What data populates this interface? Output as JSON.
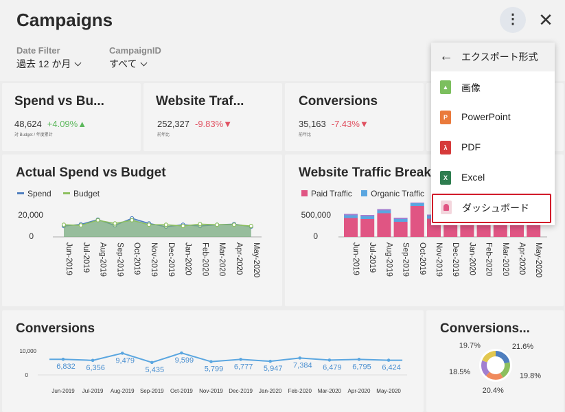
{
  "header": {
    "title": "Campaigns",
    "filters": [
      {
        "label": "Date Filter",
        "value": "過去 12 か月"
      },
      {
        "label": "CampaignID",
        "value": "すべて"
      }
    ],
    "more_icon": "⋮",
    "close_icon": "✕"
  },
  "kpis": [
    {
      "title": "Spend vs Bu...",
      "value": "48,624",
      "delta": "+4.09%▲",
      "sub": "対 Budget / 年度累計"
    },
    {
      "title": "Website Traf...",
      "value": "252,327",
      "delta": "-9.83%▼",
      "sub": "前年比"
    },
    {
      "title": "Conversions",
      "value": "35,163",
      "delta": "-7.43%▼",
      "sub": "前年比"
    }
  ],
  "months": [
    "Jun-2019",
    "Jul-2019",
    "Aug-2019",
    "Sep-2019",
    "Oct-2019",
    "Nov-2019",
    "Dec-2019",
    "Jan-2020",
    "Feb-2020",
    "Mar-2020",
    "Apr-2020",
    "May-2020"
  ],
  "spend_chart": {
    "title": "Actual Spend vs Budget",
    "legend": [
      "Spend",
      "Budget"
    ],
    "y_ticks": [
      "20,000",
      "0"
    ]
  },
  "traffic_chart": {
    "title": "Website Traffic Breakdown",
    "legend": [
      "Paid Traffic",
      "Organic Traffic"
    ],
    "y_ticks": [
      "500,000",
      "0"
    ]
  },
  "conversions_chart": {
    "title": "Conversions",
    "y_ticks": [
      "10,000",
      "0"
    ]
  },
  "donut_chart": {
    "title": "Conversions..."
  },
  "chart_data": [
    {
      "type": "area",
      "title": "Actual Spend vs Budget",
      "categories": [
        "Jun-2019",
        "Jul-2019",
        "Aug-2019",
        "Sep-2019",
        "Oct-2019",
        "Nov-2019",
        "Dec-2019",
        "Jan-2020",
        "Feb-2020",
        "Mar-2020",
        "Apr-2020",
        "May-2020"
      ],
      "ylim": [
        0,
        30000
      ],
      "series": [
        {
          "name": "Spend",
          "values": [
            8500,
            9800,
            13500,
            9000,
            14500,
            10500,
            8000,
            9500,
            8500,
            9500,
            10000,
            8000
          ]
        },
        {
          "name": "Budget",
          "values": [
            9500,
            9000,
            13000,
            10500,
            13000,
            9500,
            9500,
            8500,
            10000,
            9500,
            9500,
            8500
          ]
        }
      ],
      "colors": {
        "Spend": "#4f7fbf",
        "Budget": "#8cbf5e"
      }
    },
    {
      "type": "bar",
      "title": "Website Traffic Breakdown",
      "categories": [
        "Jun-2019",
        "Jul-2019",
        "Aug-2019",
        "Sep-2019",
        "Oct-2019",
        "Nov-2019",
        "Dec-2019",
        "Jan-2020",
        "Feb-2020",
        "Mar-2020",
        "Apr-2020",
        "May-2020"
      ],
      "ylim": [
        0,
        700000
      ],
      "series": [
        {
          "name": "Paid Traffic",
          "values": [
            275000,
            260000,
            345000,
            220000,
            450000,
            265000,
            275000,
            235000,
            270000,
            265000,
            260000,
            265000
          ]
        },
        {
          "name": "Organic Traffic",
          "values": [
            40000,
            40000,
            40000,
            40000,
            40000,
            40000,
            40000,
            40000,
            40000,
            40000,
            40000,
            40000
          ]
        }
      ],
      "colors": {
        "Paid Traffic": "#e05583",
        "Organic Traffic": "#5aa6e0"
      }
    },
    {
      "type": "line",
      "title": "Conversions",
      "categories": [
        "Jun-2019",
        "Jul-2019",
        "Aug-2019",
        "Sep-2019",
        "Oct-2019",
        "Nov-2019",
        "Dec-2019",
        "Jan-2020",
        "Feb-2020",
        "Mar-2020",
        "Apr-2020",
        "May-2020"
      ],
      "ylim": [
        0,
        12000
      ],
      "values": [
        6832,
        6356,
        9479,
        5435,
        9599,
        5799,
        6777,
        5947,
        7384,
        6479,
        6795,
        6424
      ],
      "value_labels": [
        "6,832",
        "6,356",
        "9,479",
        "5,435",
        "9,599",
        "5,799",
        "6,777",
        "5,947",
        "7,384",
        "6,479",
        "6,795",
        "6,424"
      ],
      "colors": {
        "line": "#5aa6e0"
      }
    },
    {
      "type": "pie",
      "title": "Conversions...",
      "labels": [
        "21.6%",
        "19.8%",
        "20.4%",
        "18.5%",
        "19.7%"
      ],
      "values": [
        21.6,
        19.8,
        20.4,
        18.5,
        19.7
      ],
      "colors": [
        "#4f7fbf",
        "#8cbf5e",
        "#f08a5d",
        "#a27fd0",
        "#e2c74f"
      ]
    }
  ],
  "export_menu": {
    "title": "エクスポート形式",
    "items": [
      {
        "label": "画像",
        "icon": "image-icon",
        "color": "#7cbf5e"
      },
      {
        "label": "PowerPoint",
        "icon": "powerpoint-icon",
        "color": "#ea7a3c"
      },
      {
        "label": "PDF",
        "icon": "pdf-icon",
        "color": "#d63a3a"
      },
      {
        "label": "Excel",
        "icon": "excel-icon",
        "color": "#2e7d4f"
      },
      {
        "label": "ダッシュボード",
        "icon": "dashboard-icon",
        "color": "#e9b8c4"
      }
    ]
  }
}
